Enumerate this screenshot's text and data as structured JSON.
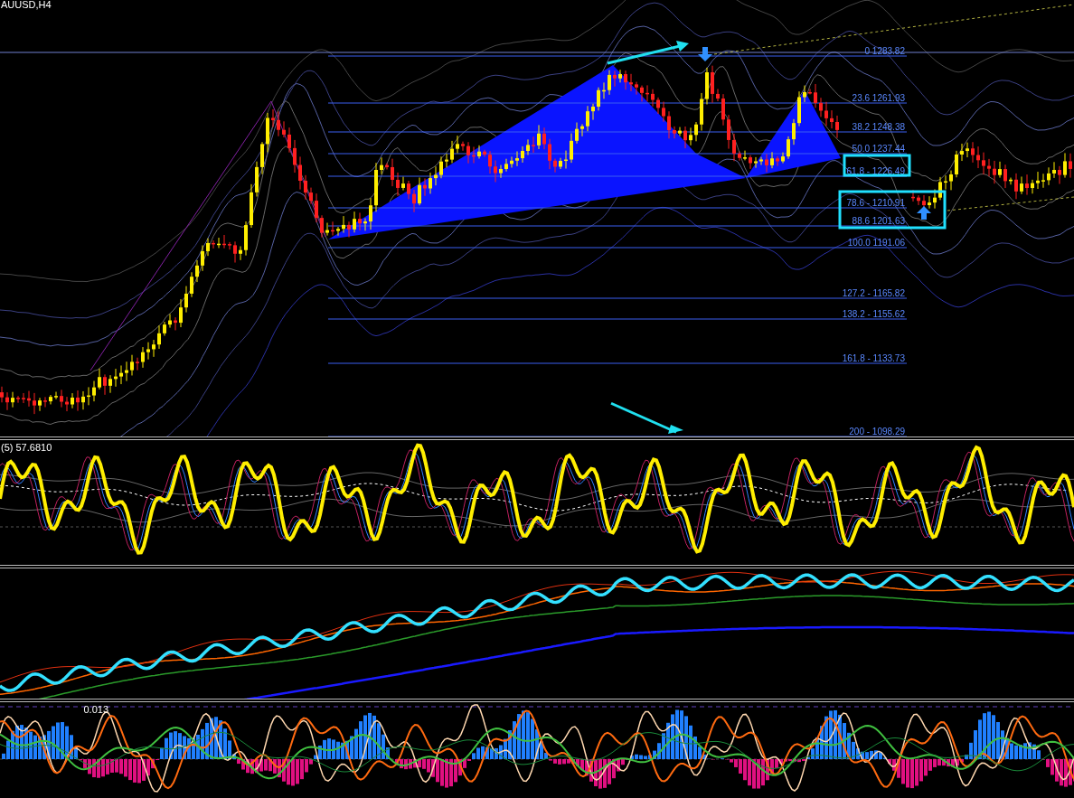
{
  "symbol": "AUUSD,H4",
  "fib_levels": [
    {
      "label": "0 1283.82"
    },
    {
      "label": "23.6 1261.93"
    },
    {
      "label": "38.2 1248.38"
    },
    {
      "label": "50.0 1237.44"
    },
    {
      "label": "61.8 - 1226.49"
    },
    {
      "label": "78.6 - 1210.91"
    },
    {
      "label": "88.6 1201.63"
    },
    {
      "label": "100.0 1191.06"
    },
    {
      "label": "127.2 - 1165.82"
    },
    {
      "label": "138.2 - 1155.62"
    },
    {
      "label": "161.8 -  1133.73"
    },
    {
      "label": "200 - 1098.29"
    }
  ],
  "indicators": [
    {
      "label": "(5) 57.6810"
    },
    {
      "label": "0.013"
    }
  ]
}
